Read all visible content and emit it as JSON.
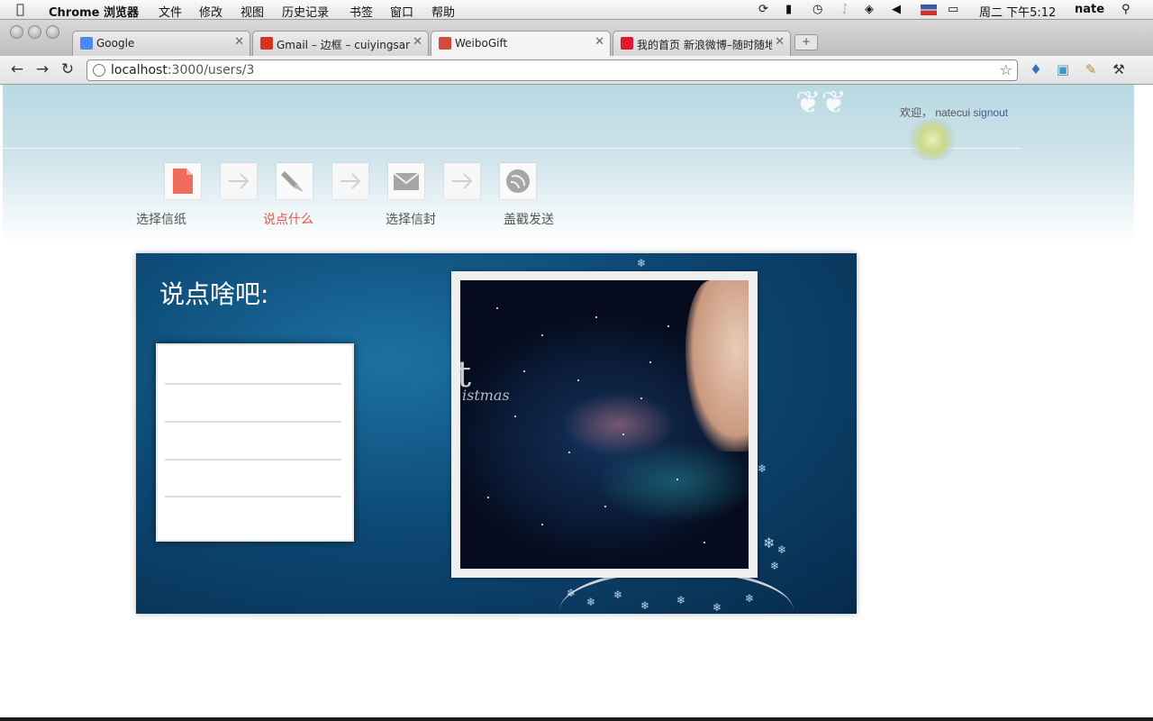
{
  "menubar": {
    "app_name": "Chrome 浏览器",
    "menus": [
      "文件",
      "修改",
      "视图",
      "历史记录",
      "书签",
      "窗口",
      "帮助"
    ],
    "clock": "周二 下午5:12",
    "user": "nate"
  },
  "tabs": [
    {
      "title": "Google",
      "favicon_color": "#4a8af4",
      "active": false
    },
    {
      "title": "Gmail – 边框 – cuiyingsan@gi",
      "favicon_color": "#d93025",
      "active": false
    },
    {
      "title": "WeiboGift",
      "favicon_color": "#d14a3b",
      "active": true
    },
    {
      "title": "我的首页 新浪微博–随时随地分",
      "favicon_color": "#e6162d",
      "active": false
    }
  ],
  "toolbar": {
    "url_host": "localhost",
    "url_path": ":3000/users/3"
  },
  "header": {
    "welcome_text": "欢迎， natecui",
    "signout_label": "signout"
  },
  "steps": [
    {
      "label": "选择信纸",
      "icon": "document-icon",
      "active": false
    },
    {
      "label": "说点什么",
      "icon": "pen-icon",
      "active": true
    },
    {
      "label": "选择信封",
      "icon": "envelope-icon",
      "active": false
    },
    {
      "label": "盖戳发送",
      "icon": "stamp-icon",
      "active": false
    }
  ],
  "card": {
    "title": "说点啥吧:",
    "photo_text": "t",
    "photo_text2": "istmas"
  },
  "colors": {
    "accent_red": "#e8534a",
    "card_blue": "#0d4a77",
    "link_blue": "#3d5b95"
  }
}
